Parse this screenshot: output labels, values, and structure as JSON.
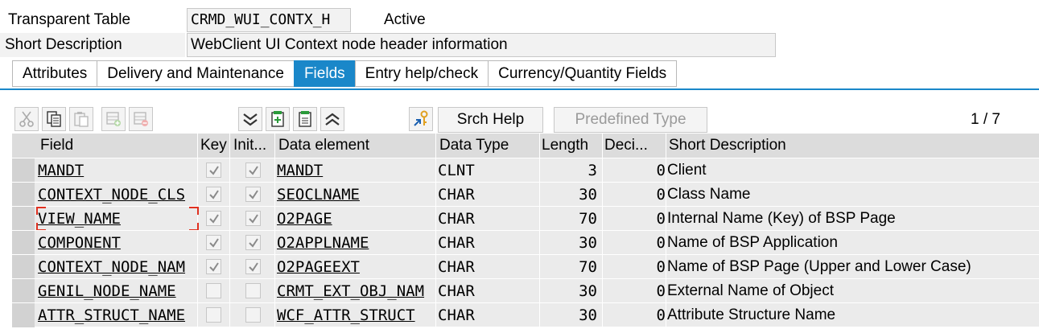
{
  "header": {
    "table_type_label": "Transparent Table",
    "table_name": "CRMD_WUI_CONTX_H",
    "status": "Active",
    "short_desc_label": "Short Description",
    "short_desc_value": "WebClient UI Context node header information"
  },
  "tabs": [
    {
      "label": "Attributes",
      "active": false
    },
    {
      "label": "Delivery and Maintenance",
      "active": false
    },
    {
      "label": "Fields",
      "active": true
    },
    {
      "label": "Entry help/check",
      "active": false
    },
    {
      "label": "Currency/Quantity Fields",
      "active": false
    }
  ],
  "toolbar": {
    "srch_help": "Srch Help",
    "predefined_type": "Predefined Type",
    "pager": "1 / 7"
  },
  "columns": [
    "Field",
    "Key",
    "Init...",
    "Data element",
    "Data Type",
    "Length",
    "Deci...",
    "Short Description"
  ],
  "rows": [
    {
      "field": "MANDT",
      "key": true,
      "init": true,
      "data_element": "MANDT",
      "data_type": "CLNT",
      "length": "3",
      "decimals": "0",
      "desc": "Client"
    },
    {
      "field": "CONTEXT_NODE_CLS",
      "key": true,
      "init": true,
      "data_element": "SEOCLNAME",
      "data_type": "CHAR",
      "length": "30",
      "decimals": "0",
      "desc": "Class Name"
    },
    {
      "field": "VIEW_NAME",
      "key": true,
      "init": true,
      "data_element": "O2PAGE",
      "data_type": "CHAR",
      "length": "70",
      "decimals": "0",
      "desc": "Internal Name (Key) of BSP Page"
    },
    {
      "field": "COMPONENT",
      "key": true,
      "init": true,
      "data_element": "O2APPLNAME",
      "data_type": "CHAR",
      "length": "30",
      "decimals": "0",
      "desc": "Name of BSP Application"
    },
    {
      "field": "CONTEXT_NODE_NAM",
      "key": true,
      "init": true,
      "data_element": "O2PAGEEXT",
      "data_type": "CHAR",
      "length": "70",
      "decimals": "0",
      "desc": "Name of BSP Page (Upper and Lower Case)"
    },
    {
      "field": "GENIL_NODE_NAME",
      "key": false,
      "init": false,
      "data_element": "CRMT_EXT_OBJ_NAM",
      "data_type": "CHAR",
      "length": "30",
      "decimals": "0",
      "desc": "External Name of Object"
    },
    {
      "field": "ATTR_STRUCT_NAME",
      "key": false,
      "init": false,
      "data_element": "WCF_ATTR_STRUCT",
      "data_type": "CHAR",
      "length": "30",
      "decimals": "0",
      "desc": "Attribute Structure Name"
    }
  ],
  "colors": {
    "accent": "#1a87c9",
    "focus": "#e03020"
  }
}
